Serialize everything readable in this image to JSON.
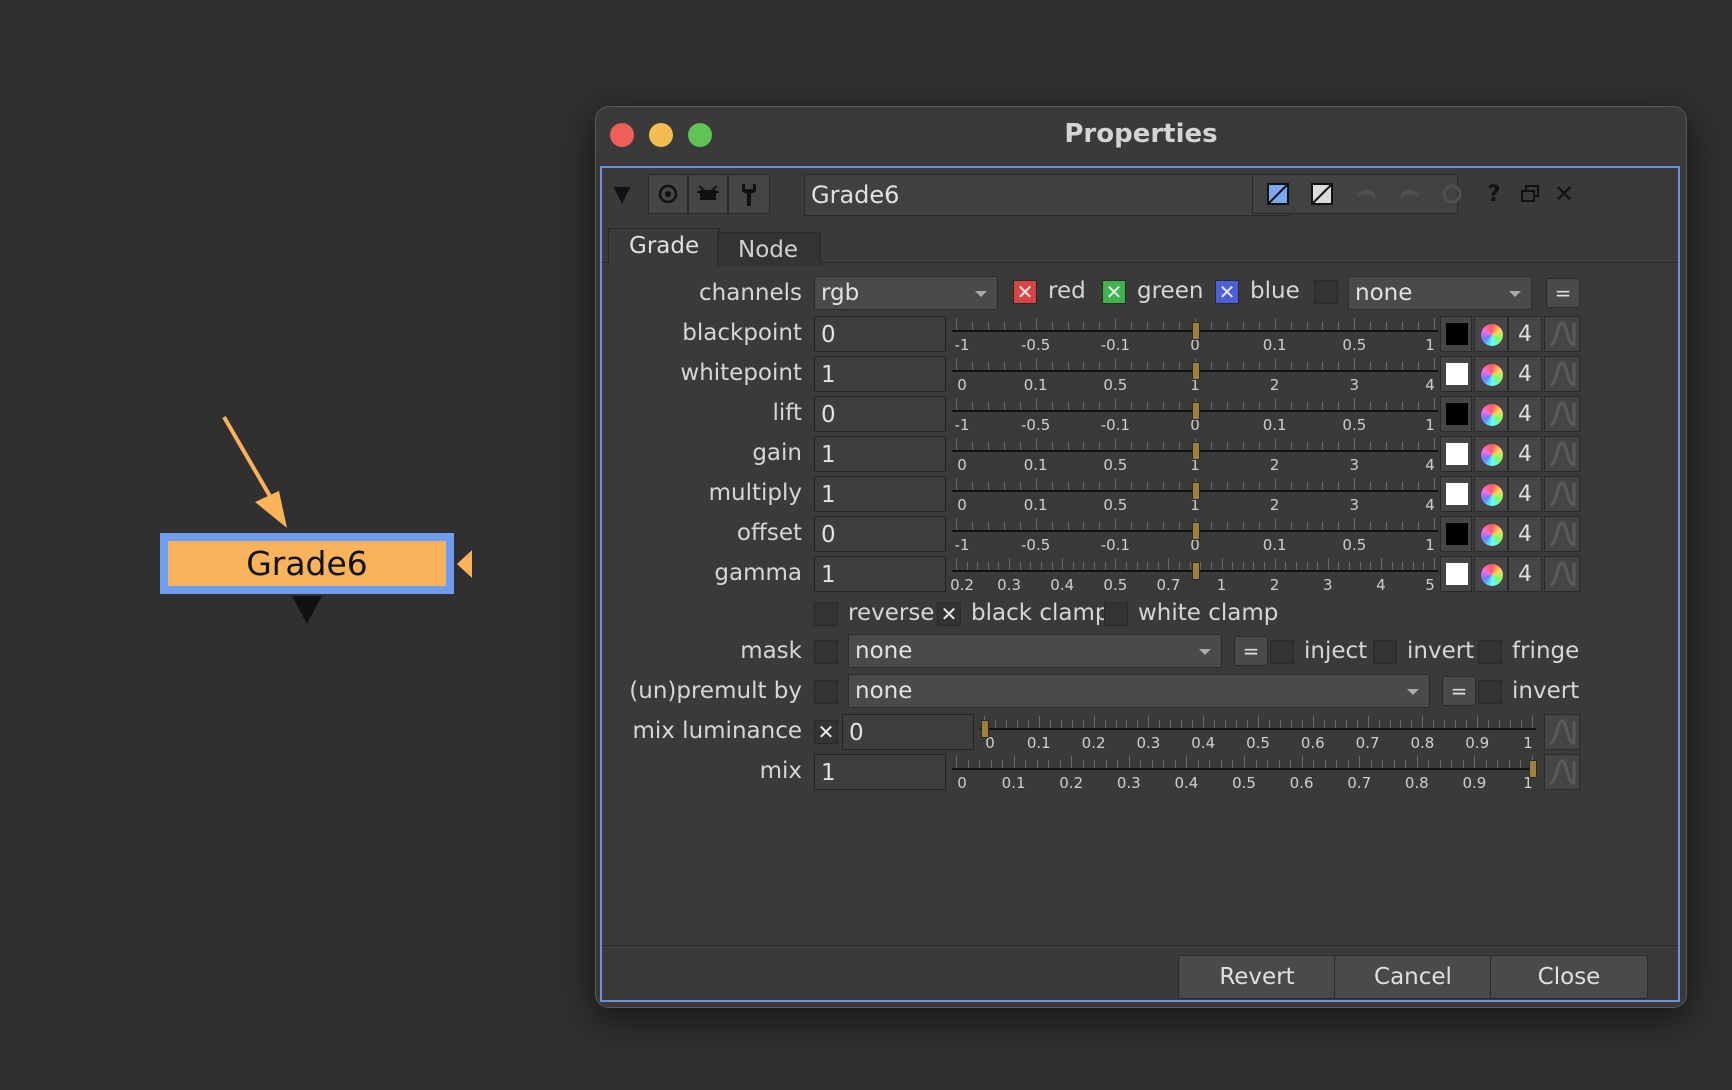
{
  "node_graph": {
    "node_label": "Grade6",
    "node_color": "#f8b35b",
    "selection_color": "#6e9df1",
    "arrow_color": "#f8b35b"
  },
  "window": {
    "title": "Properties",
    "node_name": "Grade6",
    "tabs": [
      {
        "label": "Grade"
      },
      {
        "label": "Node"
      }
    ],
    "channels": {
      "label": "channels",
      "value": "rgb",
      "red": "red",
      "green": "green",
      "blue": "blue",
      "extra_value": "none",
      "eq": "="
    },
    "rows": [
      {
        "label": "blackpoint",
        "value": "0",
        "swatch": "#000000",
        "count": "4",
        "scale": [
          "-1",
          "-0.5",
          "-0.1",
          "0",
          "0.1",
          "0.5",
          "1"
        ],
        "handle": 0.5
      },
      {
        "label": "whitepoint",
        "value": "1",
        "swatch": "#ffffff",
        "count": "4",
        "scale": [
          "0",
          "0.1",
          "0.5",
          "1",
          "2",
          "3",
          "4"
        ],
        "handle": 0.5
      },
      {
        "label": "lift",
        "value": "0",
        "swatch": "#000000",
        "count": "4",
        "scale": [
          "-1",
          "-0.5",
          "-0.1",
          "0",
          "0.1",
          "0.5",
          "1"
        ],
        "handle": 0.5
      },
      {
        "label": "gain",
        "value": "1",
        "swatch": "#ffffff",
        "count": "4",
        "scale": [
          "0",
          "0.1",
          "0.5",
          "1",
          "2",
          "3",
          "4"
        ],
        "handle": 0.5
      },
      {
        "label": "multiply",
        "value": "1",
        "swatch": "#ffffff",
        "count": "4",
        "scale": [
          "0",
          "0.1",
          "0.5",
          "1",
          "2",
          "3",
          "4"
        ],
        "handle": 0.5
      },
      {
        "label": "offset",
        "value": "0",
        "swatch": "#000000",
        "count": "4",
        "scale": [
          "-1",
          "-0.5",
          "-0.1",
          "0",
          "0.1",
          "0.5",
          "1"
        ],
        "handle": 0.5
      },
      {
        "label": "gamma",
        "value": "1",
        "swatch": "#ffffff",
        "count": "4",
        "scale": [
          "0.2",
          "0.3",
          "0.4",
          "0.5",
          "0.7",
          "1",
          "2",
          "3",
          "4",
          "5"
        ],
        "handle": 0.5
      }
    ],
    "clamp": {
      "reverse": "reverse",
      "black_clamp": "black clamp",
      "white_clamp": "white clamp"
    },
    "mask": {
      "label": "mask",
      "value": "none",
      "eq": "=",
      "inject": "inject",
      "invert": "invert",
      "fringe": "fringe"
    },
    "premult": {
      "label": "(un)premult by",
      "value": "none",
      "eq": "=",
      "invert": "invert"
    },
    "mix_luminance": {
      "label": "mix luminance",
      "value": "0",
      "scale": [
        "0",
        "0.1",
        "0.2",
        "0.3",
        "0.4",
        "0.5",
        "0.6",
        "0.7",
        "0.8",
        "0.9",
        "1"
      ],
      "handle": 0
    },
    "mix": {
      "label": "mix",
      "value": "1",
      "scale": [
        "0",
        "0.1",
        "0.2",
        "0.3",
        "0.4",
        "0.5",
        "0.6",
        "0.7",
        "0.8",
        "0.9",
        "1"
      ],
      "handle": 1
    },
    "buttons": {
      "revert": "Revert",
      "cancel": "Cancel",
      "close": "Close"
    },
    "colors": {
      "red": "#d64545",
      "green": "#3fb34f",
      "blue": "#4b5fd6",
      "accent_border": "#6a93d8"
    }
  }
}
